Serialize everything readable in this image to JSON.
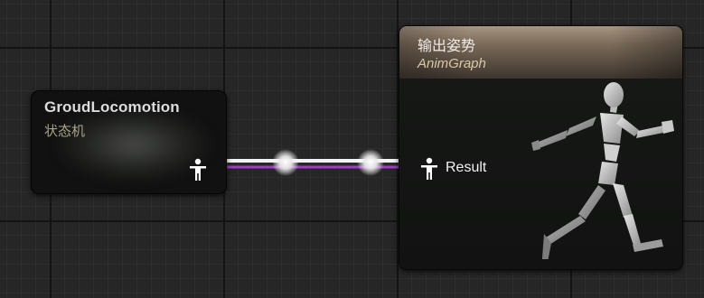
{
  "graph": {
    "background_color": "#262626",
    "wire_colors": {
      "exec": "#ffffff",
      "pose": "#9b3fc4"
    }
  },
  "state_machine_node": {
    "title": "GroudLocomotion",
    "subtitle": "状态机",
    "output_pin_icon": "pose-pin-icon"
  },
  "output_pose_node": {
    "title": "输出姿势",
    "subtitle": "AnimGraph",
    "header_color": "#a89582",
    "input_pin_icon": "pose-pin-icon",
    "input_pin_label": "Result",
    "preview_icon": "running-mannequin-icon"
  }
}
